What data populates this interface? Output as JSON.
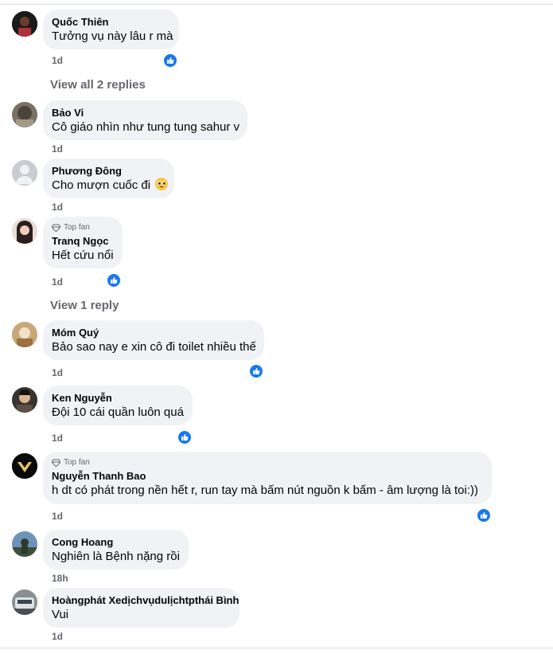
{
  "comments": [
    {
      "author": "Quốc Thiên",
      "text": "Tưởng vụ này lâu r mà",
      "time": "1d",
      "liked": true
    },
    {
      "author": "Bảo Vi",
      "text": "Cô giáo nhìn như tung tung sahur v",
      "time": "1d",
      "liked": false
    },
    {
      "author": "Phương Đông",
      "text": "Cho mượn cuốc đi",
      "time": "1d",
      "liked": false,
      "emoji": "pleading-face-emoji"
    },
    {
      "author": "Tranq Ngọc",
      "badge": "Top fan",
      "text": "Hết cứu nổi",
      "time": "1d",
      "liked": true
    },
    {
      "author": "Móm Quý",
      "text": "Bảo sao nay e xin cô đi toilet nhiều thế",
      "time": "1d",
      "liked": true
    },
    {
      "author": "Ken Nguyễn",
      "text": "Đội 10 cái quần luôn quá",
      "time": "1d",
      "liked": true
    },
    {
      "author": "Nguyễn Thanh Bao",
      "badge": "Top fan",
      "text": "h dt có phát trong nền hết r, run tay mà bấm nút nguồn k bấm - âm lượng là toi:))",
      "time": "1d",
      "liked": true
    },
    {
      "author": "Cong Hoang",
      "text": "Nghiên là Bệnh nặng rồi",
      "time": "18h",
      "liked": false
    },
    {
      "author": "Hoàngphát Xedịchvụdulịchtpthái Bình",
      "text": "Vui",
      "time": "1d",
      "liked": false
    }
  ],
  "replies": {
    "first": "View all 2 replies",
    "second": "View 1 reply"
  },
  "colors": {
    "bubble": "#f0f2f5",
    "like": "#1877f2",
    "secondary_text": "#65676b"
  },
  "icons": {
    "like": "thumbs-up-icon",
    "badge": "diamond-icon"
  }
}
